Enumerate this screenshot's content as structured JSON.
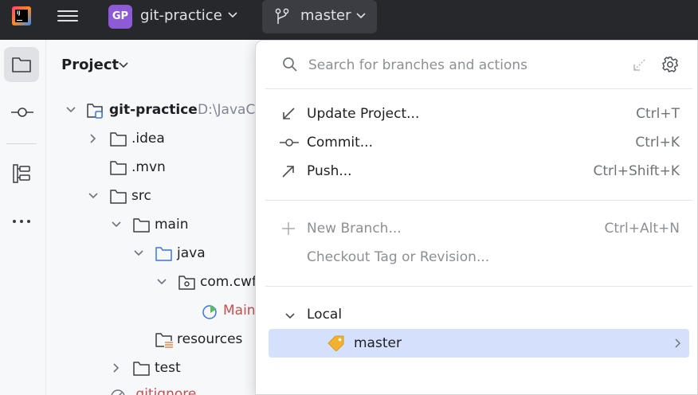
{
  "titlebar": {
    "project_badge": "GP",
    "project_name": "git-practice",
    "branch_name": "master",
    "accent_badge_color": "#8d5bd6"
  },
  "toolstrip": {
    "icons": [
      "folder-icon",
      "commit-icon",
      "structure-icon",
      "more-icon"
    ]
  },
  "project_panel": {
    "title": "Project",
    "tree": [
      {
        "label": "git-practice",
        "path": "D:\\JavaC",
        "bold": true
      },
      {
        "label": ".idea"
      },
      {
        "label": ".mvn"
      },
      {
        "label": "src"
      },
      {
        "label": "main"
      },
      {
        "label": "java"
      },
      {
        "label": "com.cwf"
      },
      {
        "label": "Main"
      },
      {
        "label": "resources"
      },
      {
        "label": "test"
      },
      {
        "label": ".gitignore"
      }
    ]
  },
  "popup": {
    "search": {
      "placeholder": "Search for branches and actions",
      "value": ""
    },
    "actions": [
      {
        "label": "Update Project...",
        "shortcut": "Ctrl+T",
        "icon": "update-arrow-icon"
      },
      {
        "label": "Commit...",
        "shortcut": "Ctrl+K",
        "icon": "commit-icon"
      },
      {
        "label": "Push...",
        "shortcut": "Ctrl+Shift+K",
        "icon": "push-arrow-icon"
      }
    ],
    "branch_actions": [
      {
        "label": "New Branch...",
        "shortcut": "Ctrl+Alt+N",
        "icon": "plus-icon",
        "disabled": true
      },
      {
        "label": "Checkout Tag or Revision...",
        "shortcut": "",
        "disabled": true
      }
    ],
    "local_section": {
      "label": "Local",
      "branches": [
        {
          "name": "master",
          "icon": "tag-icon",
          "selected": true
        }
      ]
    },
    "selected_color": "#d5e1fc"
  }
}
